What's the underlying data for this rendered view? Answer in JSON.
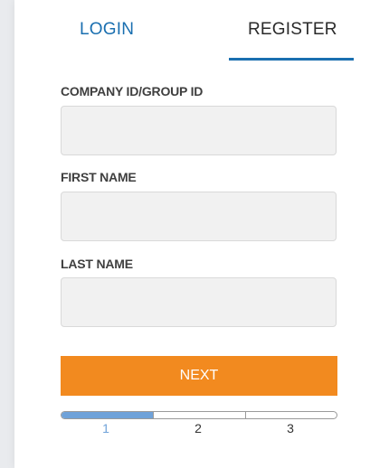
{
  "tabs": {
    "login_label": "LOGIN",
    "register_label": "REGISTER",
    "active": "register"
  },
  "form": {
    "company_label": "COMPANY ID/GROUP ID",
    "company_value": "",
    "first_name_label": "FIRST NAME",
    "first_name_value": "",
    "last_name_label": "LAST NAME",
    "last_name_value": "",
    "next_label": "NEXT"
  },
  "progress": {
    "current_step": 1,
    "total_steps": 3,
    "steps": [
      "1",
      "2",
      "3"
    ]
  },
  "colors": {
    "accent": "#1a6fb0",
    "button": "#f28a1f",
    "progress_fill": "#6fa2d9"
  }
}
